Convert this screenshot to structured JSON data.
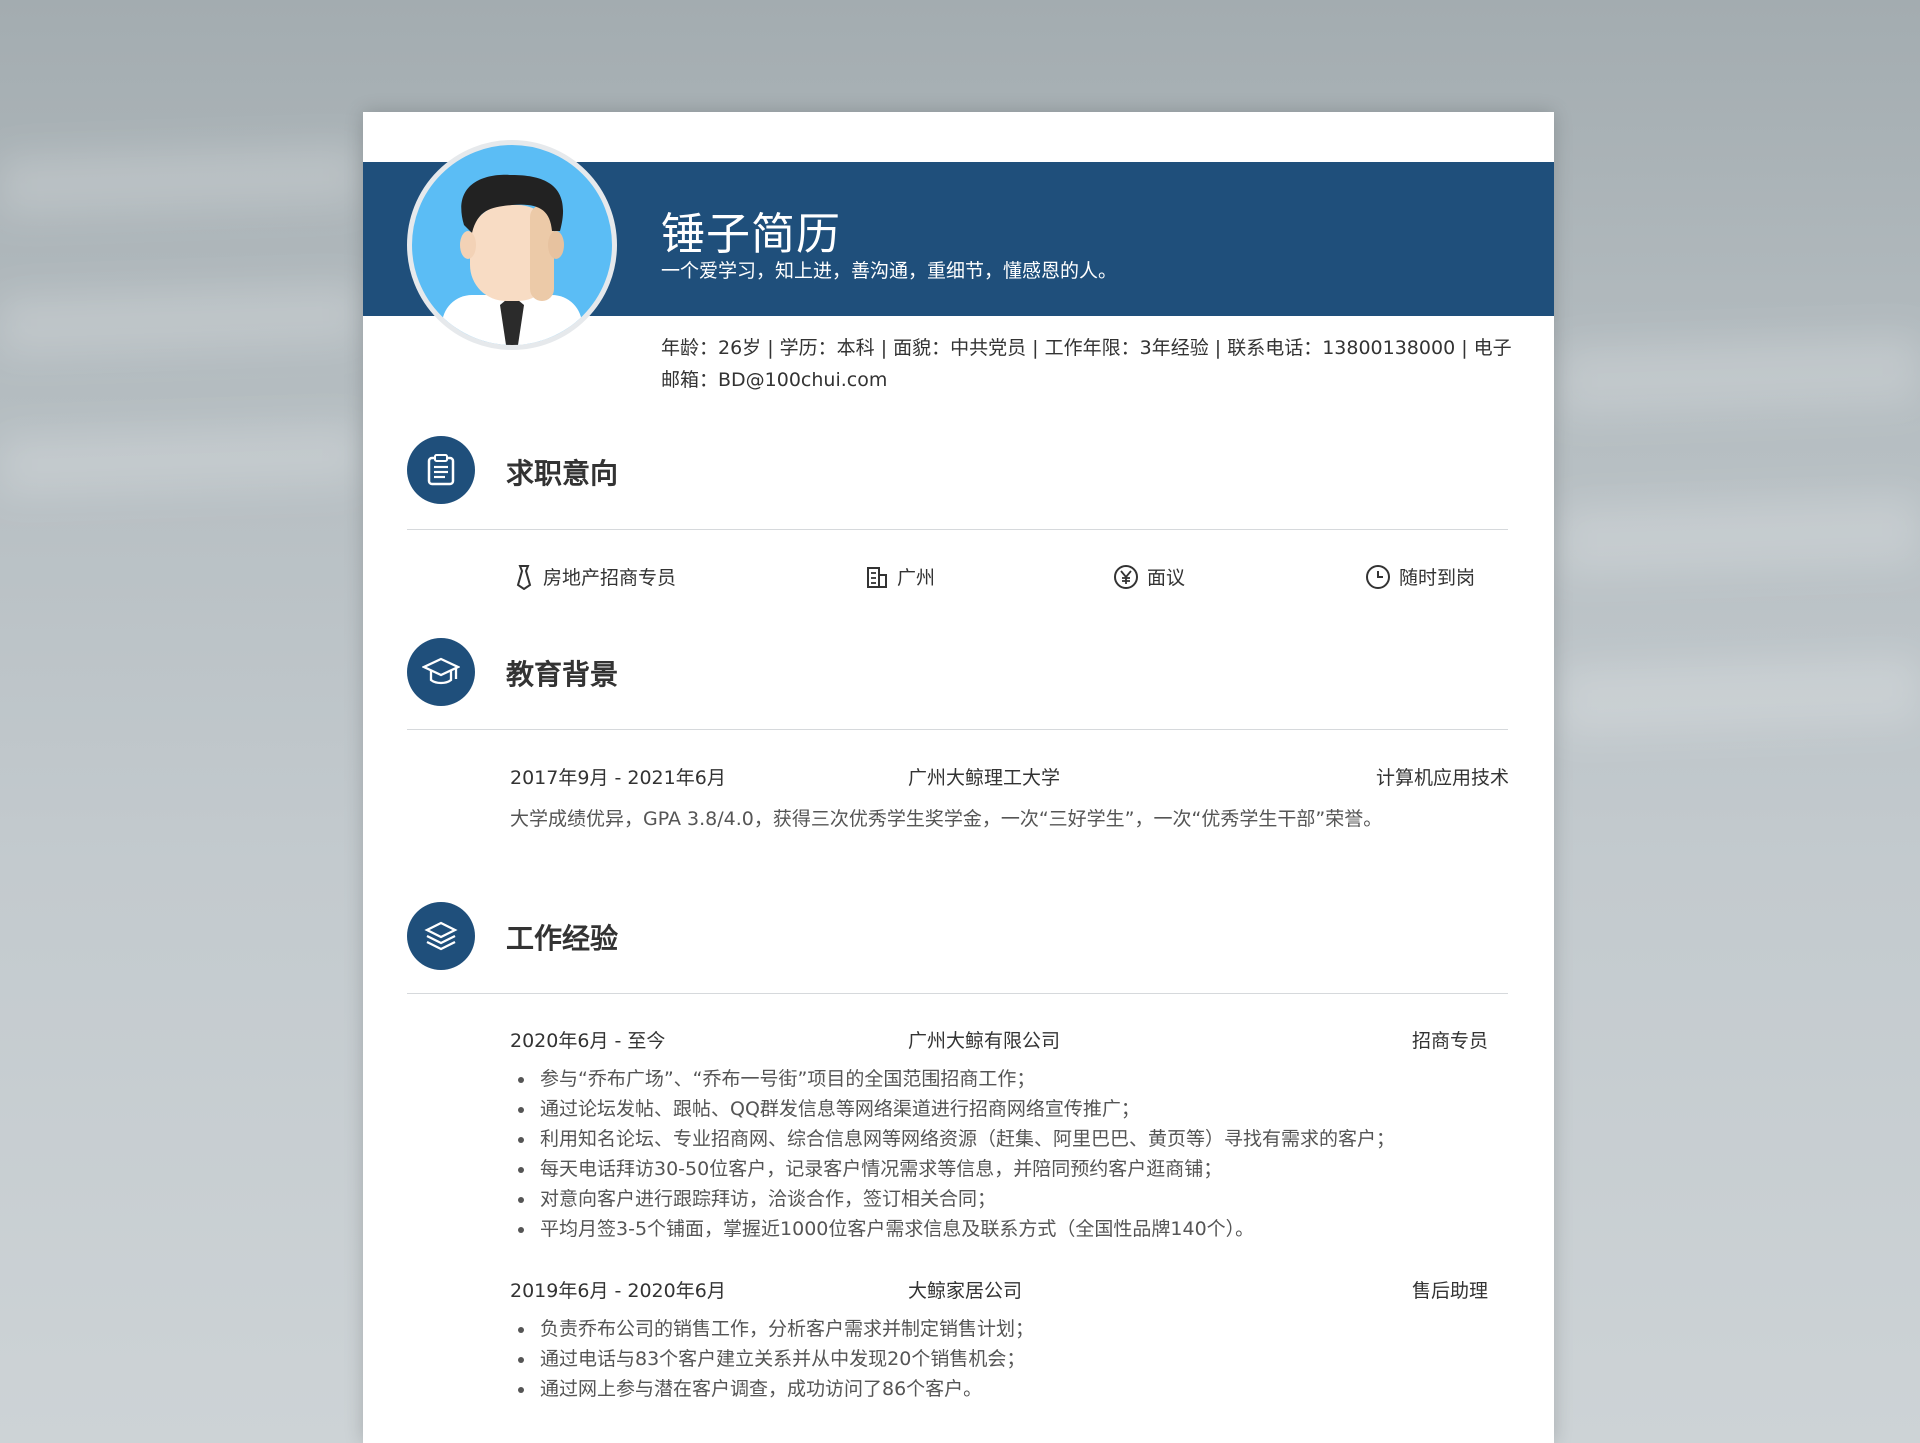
{
  "header": {
    "name": "锤子简历",
    "motto": "一个爱学习，知上进，善沟通，重细节，懂感恩的人。",
    "info": "年龄：26岁 | 学历：本科 | 面貌：中共党员 | 工作年限：3年经验 | 联系电话：13800138000 | 电子邮箱：BD@100chui.com"
  },
  "intent": {
    "title": "求职意向",
    "items": [
      {
        "icon": "tie-icon",
        "label": "房地产招商专员"
      },
      {
        "icon": "building-icon",
        "label": "广州"
      },
      {
        "icon": "yen-icon",
        "label": "面议"
      },
      {
        "icon": "clock-icon",
        "label": "随时到岗"
      }
    ]
  },
  "education": {
    "title": "教育背景",
    "period": "2017年9月 - 2021年6月",
    "school": "广州大鲸理工大学",
    "major": "计算机应用技术",
    "desc": "大学成绩优异，GPA 3.8/4.0，获得三次优秀学生奖学金，一次“三好学生”，一次“优秀学生干部”荣誉。"
  },
  "work": {
    "title": "工作经验",
    "jobs": [
      {
        "period": "2020年6月 - 至今",
        "company": "广州大鲸有限公司",
        "role": "招商专员",
        "bullets": [
          "参与“乔布广场”、“乔布一号街”项目的全国范围招商工作；",
          "通过论坛发帖、跟帖、QQ群发信息等网络渠道进行招商网络宣传推广；",
          "利用知名论坛、专业招商网、综合信息网等网络资源（赶集、阿里巴巴、黄页等）寻找有需求的客户；",
          "每天电话拜访30-50位客户，记录客户情况需求等信息，并陪同预约客户逛商铺；",
          "对意向客户进行跟踪拜访，洽谈合作，签订相关合同；",
          "平均月签3-5个铺面，掌握近1000位客户需求信息及联系方式（全国性品牌140个）。"
        ]
      },
      {
        "period": "2019年6月 - 2020年6月",
        "company": "大鲸家居公司",
        "role": "售后助理",
        "bullets": [
          "负责乔布公司的销售工作，分析客户需求并制定销售计划；",
          "通过电话与83个客户建立关系并从中发现20个销售机会；",
          "通过网上参与潜在客户调查，成功访问了86个客户。"
        ]
      }
    ]
  },
  "colors": {
    "accent": "#1f4f7b",
    "avatar_bg": "#5bbdf5",
    "background": "#b6bec2"
  }
}
